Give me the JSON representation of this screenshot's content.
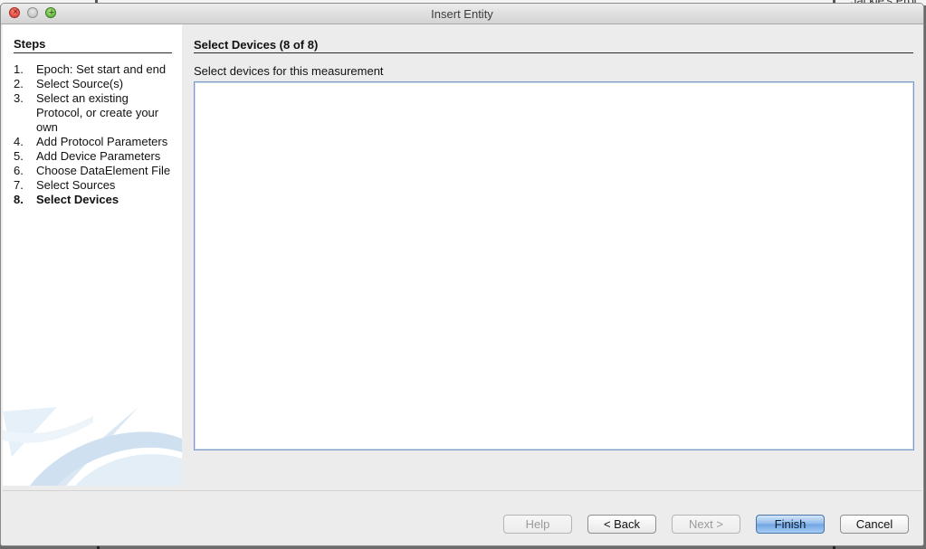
{
  "window": {
    "title": "Insert Entity"
  },
  "background": {
    "text": "Jackie's Proj"
  },
  "steps": {
    "title": "Steps",
    "items": [
      {
        "num": "1.",
        "label": "Epoch: Set start and end",
        "current": false
      },
      {
        "num": "2.",
        "label": "Select Source(s)",
        "current": false
      },
      {
        "num": "3.",
        "label": "Select an existing Protocol, or create your own",
        "current": false
      },
      {
        "num": "4.",
        "label": "Add Protocol Parameters",
        "current": false
      },
      {
        "num": "5.",
        "label": "Add Device Parameters",
        "current": false
      },
      {
        "num": "6.",
        "label": "Choose DataElement File",
        "current": false
      },
      {
        "num": "7.",
        "label": "Select Sources",
        "current": false
      },
      {
        "num": "8.",
        "label": "Select Devices",
        "current": true
      }
    ]
  },
  "content": {
    "title": "Select Devices (8 of 8)",
    "description": "Select devices for this measurement",
    "devices": []
  },
  "buttons": {
    "help": {
      "label": "Help",
      "enabled": false
    },
    "back": {
      "label": "< Back",
      "enabled": true
    },
    "next": {
      "label": "Next >",
      "enabled": false
    },
    "finish": {
      "label": "Finish",
      "enabled": true,
      "default": true
    },
    "cancel": {
      "label": "Cancel",
      "enabled": true
    }
  },
  "colors": {
    "accent": "#6fa4e3",
    "list_border": "#7b9bc4"
  }
}
